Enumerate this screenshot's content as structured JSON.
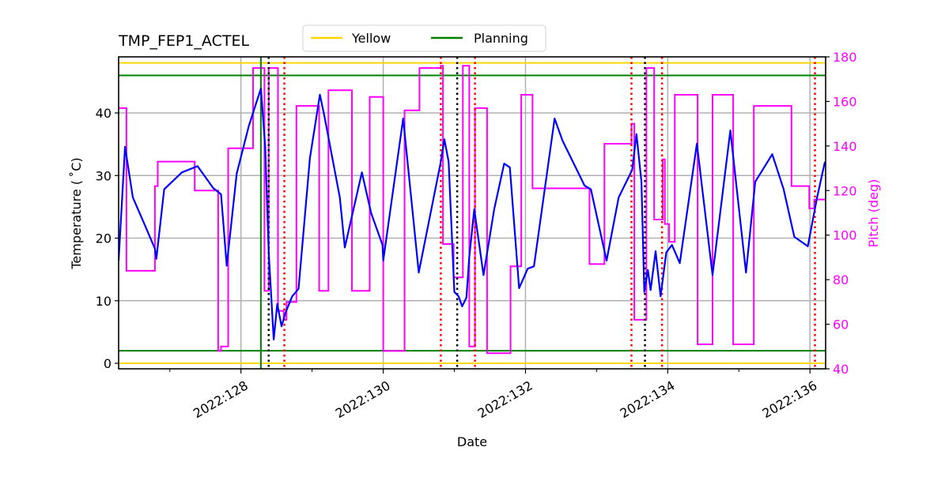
{
  "chart_data": {
    "type": "line",
    "title": "TMP_FEP1_ACTEL",
    "xlabel": "Date",
    "ylabel": "Temperature ($^\\circ$C)",
    "ylabel_display": "Temperature ( ˚C)",
    "y2label": "Pitch (deg)",
    "xlim": [
      126.28,
      136.22
    ],
    "ylim": [
      -1,
      49
    ],
    "y2lim": [
      40,
      180
    ],
    "x_ticks": [
      {
        "value": 128,
        "label": "2022:128"
      },
      {
        "value": 130,
        "label": "2022:130"
      },
      {
        "value": 132,
        "label": "2022:132"
      },
      {
        "value": 134,
        "label": "2022:134"
      },
      {
        "value": 136,
        "label": "2022:136"
      }
    ],
    "x_minor_ticks": [
      127,
      129,
      131,
      133,
      135
    ],
    "y_ticks": [
      0,
      10,
      20,
      30,
      40
    ],
    "y2_ticks": [
      40,
      60,
      80,
      100,
      120,
      140,
      160,
      180
    ],
    "grid": true,
    "legend": {
      "placement": "top-center",
      "entries": [
        {
          "label": "Yellow",
          "color": "#FFD700"
        },
        {
          "label": "Planning",
          "color": "#008000"
        }
      ]
    },
    "limits": {
      "yellow": [
        0,
        48
      ],
      "planning": [
        2,
        46
      ]
    },
    "colors": {
      "temperature": "#0000FF",
      "pitch": "#FF00FF",
      "yellow": "#FFD700",
      "planning": "#008000",
      "grid": "#B0B0B0",
      "red_vlines": "#FF0000",
      "black_vlines": "#000000",
      "pitch_axis": "#FF00FF"
    },
    "vertical_lines": {
      "planning_solid": [
        128.28
      ],
      "black_dotted": [
        128.39,
        131.04,
        133.68
      ],
      "red_dotted": [
        128.61,
        130.81,
        131.29,
        133.49,
        133.92,
        136.07
      ]
    },
    "series": [
      {
        "name": "TMP_FEP1_ACTEL",
        "axis": "left",
        "x": [
          126.28,
          126.37,
          126.48,
          126.67,
          126.79,
          126.81,
          126.92,
          127.17,
          127.39,
          127.61,
          127.72,
          127.8,
          127.94,
          128.11,
          128.28,
          128.34,
          128.39,
          128.46,
          128.51,
          128.57,
          128.63,
          128.72,
          128.81,
          128.97,
          129.11,
          129.17,
          129.39,
          129.46,
          129.7,
          129.83,
          129.99,
          130.0,
          130.28,
          130.5,
          130.81,
          130.86,
          130.92,
          131.0,
          131.06,
          131.11,
          131.17,
          131.21,
          131.28,
          131.41,
          131.56,
          131.7,
          131.78,
          131.91,
          132.03,
          132.12,
          132.41,
          132.52,
          132.83,
          132.92,
          133.14,
          133.31,
          133.5,
          133.56,
          133.63,
          133.67,
          133.72,
          133.76,
          133.83,
          133.9,
          133.98,
          134.06,
          134.17,
          134.41,
          134.63,
          134.88,
          135.1,
          135.23,
          135.47,
          135.63,
          135.78,
          135.97,
          136.1,
          136.21
        ],
        "y": [
          16.4,
          34.6,
          26.5,
          21.5,
          18.3,
          16.7,
          27.8,
          30.5,
          31.5,
          28.0,
          27.0,
          15.6,
          30.3,
          37.9,
          43.9,
          34.7,
          17.7,
          3.8,
          9.5,
          5.9,
          8.2,
          10.7,
          11.9,
          32.8,
          42.9,
          39.7,
          26.5,
          18.5,
          30.5,
          24.0,
          18.9,
          16.4,
          39.1,
          14.5,
          32.2,
          35.8,
          32.2,
          11.4,
          10.7,
          9.1,
          10.5,
          17.0,
          24.6,
          14.1,
          24.6,
          31.9,
          31.3,
          12.0,
          15.1,
          15.5,
          39.1,
          35.6,
          28.4,
          27.8,
          16.4,
          26.5,
          30.9,
          36.6,
          29.0,
          11.4,
          14.9,
          11.7,
          17.9,
          10.7,
          17.7,
          18.9,
          16.0,
          35.1,
          14.1,
          37.2,
          14.5,
          29.0,
          33.4,
          27.8,
          20.2,
          18.7,
          26.5,
          32.2
        ]
      },
      {
        "name": "Pitch",
        "axis": "right",
        "step": true,
        "x": [
          126.28,
          126.39,
          126.39,
          126.79,
          126.79,
          126.83,
          126.83,
          127.35,
          127.35,
          127.68,
          127.68,
          127.72,
          127.72,
          127.82,
          127.82,
          128.17,
          128.17,
          128.33,
          128.33,
          128.39,
          128.39,
          128.52,
          128.52,
          128.6,
          128.6,
          128.64,
          128.64,
          128.78,
          128.78,
          129.1,
          129.1,
          129.23,
          129.23,
          129.56,
          129.56,
          129.81,
          129.81,
          130.0,
          130.0,
          130.3,
          130.3,
          130.51,
          130.51,
          130.81,
          130.81,
          130.84,
          130.84,
          130.99,
          130.99,
          131.12,
          131.12,
          131.21,
          131.21,
          131.29,
          131.29,
          131.46,
          131.46,
          131.79,
          131.79,
          131.94,
          131.94,
          132.1,
          132.1,
          132.43,
          132.43,
          132.9,
          132.9,
          133.11,
          133.11,
          133.49,
          133.49,
          133.53,
          133.53,
          133.7,
          133.7,
          133.81,
          133.81,
          133.93,
          133.93,
          133.96,
          133.96,
          134.02,
          134.02,
          134.1,
          134.1,
          134.42,
          134.42,
          134.63,
          134.63,
          134.92,
          134.92,
          135.21,
          135.21,
          135.74,
          135.74,
          135.99,
          135.99,
          136.06,
          136.06,
          136.22
        ],
        "y": [
          157,
          157,
          84,
          84,
          122,
          122,
          133,
          133,
          120,
          120,
          48,
          48,
          50,
          50,
          139,
          139,
          175,
          175,
          75,
          75,
          175,
          175,
          66,
          66,
          62,
          62,
          70,
          70,
          158,
          158,
          75,
          75,
          165,
          165,
          75,
          75,
          162,
          162,
          48,
          48,
          156,
          156,
          175,
          175,
          176,
          176,
          96,
          96,
          81,
          81,
          176,
          176,
          50,
          50,
          157,
          157,
          47,
          47,
          86,
          86,
          163,
          163,
          121,
          121,
          121,
          121,
          87,
          87,
          141,
          141,
          150,
          150,
          62,
          62,
          175,
          175,
          107,
          107,
          134,
          134,
          105,
          105,
          97,
          97,
          163,
          163,
          51,
          51,
          163,
          163,
          51,
          51,
          158,
          158,
          122,
          122,
          112,
          112,
          116,
          116,
          131
        ]
      }
    ]
  }
}
